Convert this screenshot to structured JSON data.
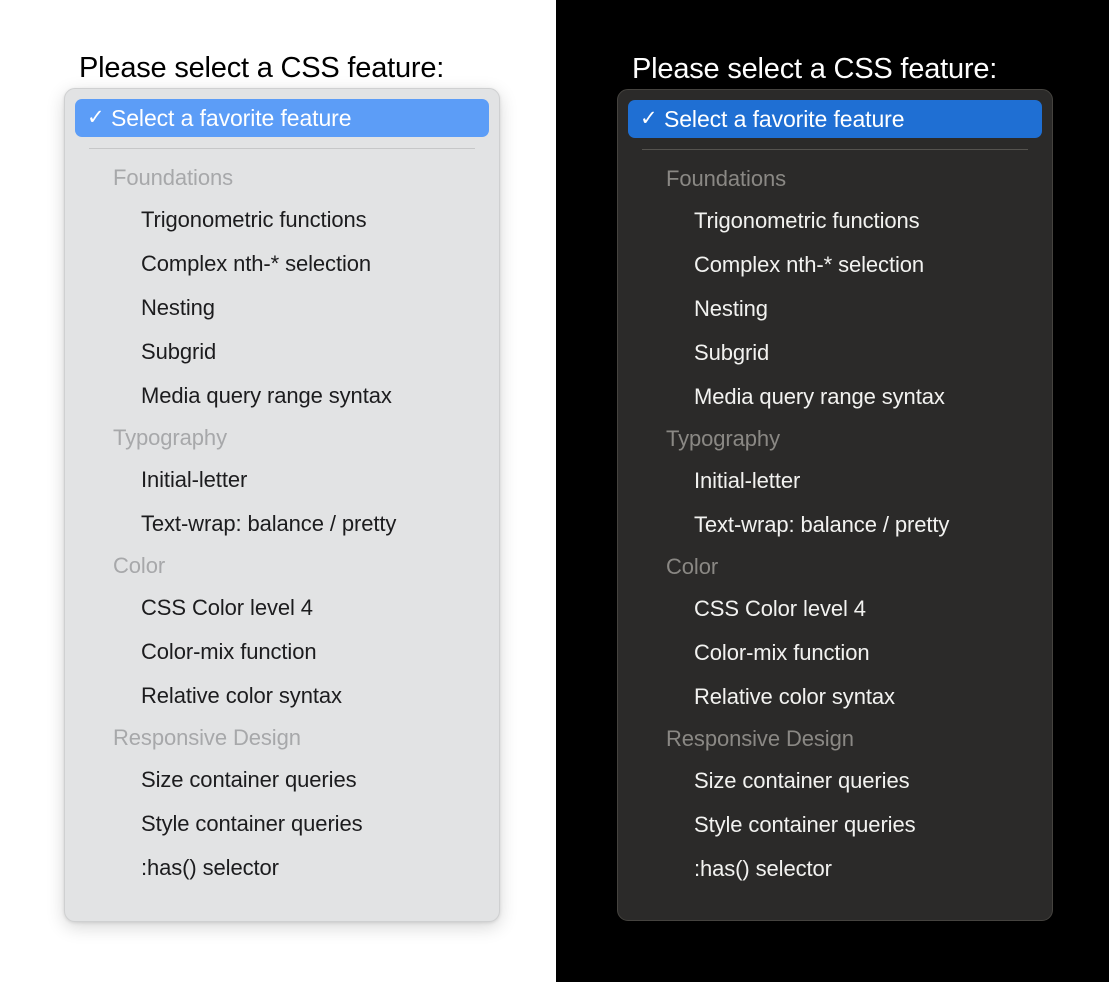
{
  "panes": [
    {
      "id": "light",
      "theme": "light",
      "heading": "Please select a CSS feature:"
    },
    {
      "id": "dark",
      "theme": "dark",
      "heading": "Please select a CSS feature:"
    }
  ],
  "select": {
    "selected_option": "Select a favorite feature",
    "checkmark": "check-icon",
    "checkmark_glyph": "✓",
    "groups": [
      {
        "label": "Foundations",
        "options": [
          "Trigonometric functions",
          "Complex nth-* selection",
          "Nesting",
          "Subgrid",
          "Media query range syntax"
        ]
      },
      {
        "label": "Typography",
        "options": [
          "Initial-letter",
          "Text-wrap: balance / pretty"
        ]
      },
      {
        "label": "Color",
        "options": [
          "CSS Color level 4",
          "Color-mix function",
          "Relative color syntax"
        ]
      },
      {
        "label": "Responsive Design",
        "options": [
          "Size container queries",
          "Style container queries",
          ":has() selector"
        ]
      }
    ]
  },
  "colors": {
    "light_background": "#ffffff",
    "light_popup_background": "#e2e3e4",
    "light_highlight": "#5c9df7",
    "light_text": "#1c1c1e",
    "light_group_label": "#a7a8aa",
    "dark_background": "#000000",
    "dark_popup_background": "#2b2a29",
    "dark_highlight": "#1f6fd3",
    "dark_text": "#f2f2f0",
    "dark_group_label": "#8a8884",
    "selected_text": "#ffffff"
  }
}
